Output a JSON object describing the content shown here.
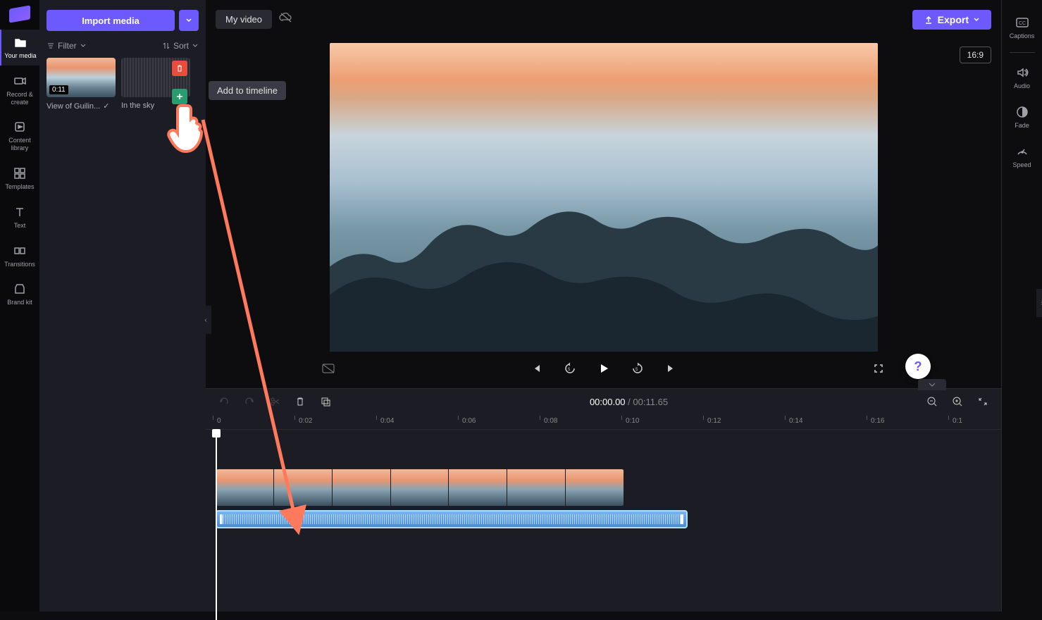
{
  "nav": {
    "items": [
      {
        "label": "Your media"
      },
      {
        "label": "Record & create"
      },
      {
        "label": "Content library"
      },
      {
        "label": "Templates"
      },
      {
        "label": "Text"
      },
      {
        "label": "Transitions"
      },
      {
        "label": "Brand kit"
      }
    ]
  },
  "media": {
    "import_label": "Import media",
    "filter_label": "Filter",
    "sort_label": "Sort",
    "thumbs": [
      {
        "label": "View of Guilin...",
        "duration": "0:11",
        "checked": true
      },
      {
        "label": "In the sky"
      }
    ]
  },
  "tooltip": "Add to timeline",
  "topbar": {
    "title": "My video",
    "export_label": "Export",
    "aspect": "16:9"
  },
  "controls": {},
  "timeline": {
    "current": "00:00.00",
    "total": "00:11.65",
    "ruler": [
      "0",
      "0:02",
      "0:04",
      "0:06",
      "0:08",
      "0:10",
      "0:12",
      "0:14",
      "0:16",
      "0:1"
    ]
  },
  "props": {
    "items": [
      {
        "label": "Captions"
      },
      {
        "label": "Audio"
      },
      {
        "label": "Fade"
      },
      {
        "label": "Speed"
      }
    ]
  },
  "help": "?"
}
